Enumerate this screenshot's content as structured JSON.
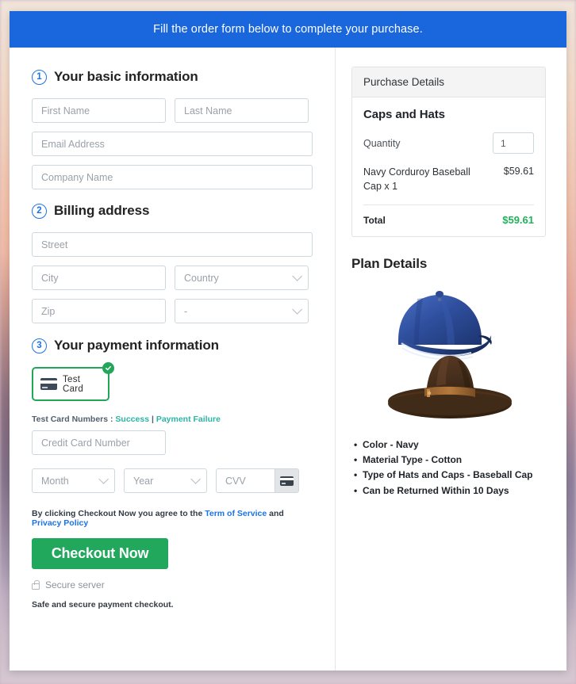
{
  "banner": {
    "text": "Fill the order form below to complete your purchase."
  },
  "basic_info": {
    "step": "1",
    "title": "Your basic information",
    "first_name_placeholder": "First Name",
    "last_name_placeholder": "Last Name",
    "email_placeholder": "Email Address",
    "company_placeholder": "Company Name"
  },
  "billing": {
    "step": "2",
    "title": "Billing address",
    "street_placeholder": "Street",
    "city_placeholder": "City",
    "country_value": "Country",
    "zip_placeholder": "Zip",
    "state_value": "-"
  },
  "payment": {
    "step": "3",
    "title": "Your payment information",
    "test_card_label": "Test Card",
    "check_icon": "check-circle-icon",
    "card_icon": "credit-card-icon",
    "test_numbers_prefix": "Test Card Numbers : ",
    "success_link": "Success",
    "separator": " | ",
    "failure_link": "Payment Failure",
    "cc_number_placeholder": "Credit Card Number",
    "month_value": "Month",
    "year_value": "Year",
    "cvv_placeholder": "CVV",
    "cvv_icon": "credit-card-icon"
  },
  "footer": {
    "terms_prefix": "By clicking Checkout Now you agree to the ",
    "terms_link": "Term of Service",
    "terms_middle": " and ",
    "privacy_link": "Privacy Policy",
    "checkout_label": "Checkout Now",
    "lock_icon": "lock-icon",
    "secure_label": "Secure server",
    "safe_note": "Safe and secure payment checkout."
  },
  "purchase_details": {
    "header": "Purchase Details",
    "product_title": "Caps and Hats",
    "quantity_label": "Quantity",
    "quantity_value": "1",
    "line_item_name": "Navy Corduroy Baseball Cap x 1",
    "line_item_price": "$59.61",
    "total_label": "Total",
    "total_value": "$59.61"
  },
  "plan_details": {
    "title": "Plan Details",
    "image_name": "caps-and-hats-product-image",
    "bullets": [
      "Color - Navy",
      "Material Type - Cotton",
      "Type of Hats and Caps - Baseball Cap",
      "Can be Returned Within 10 Days"
    ]
  },
  "colors": {
    "banner_blue": "#1a66dd",
    "accent_blue": "#1a73e8",
    "green": "#22a85c",
    "total_green": "#21b05c",
    "teal_link": "#2bb5a5",
    "card_navy": "#3f4a59"
  }
}
